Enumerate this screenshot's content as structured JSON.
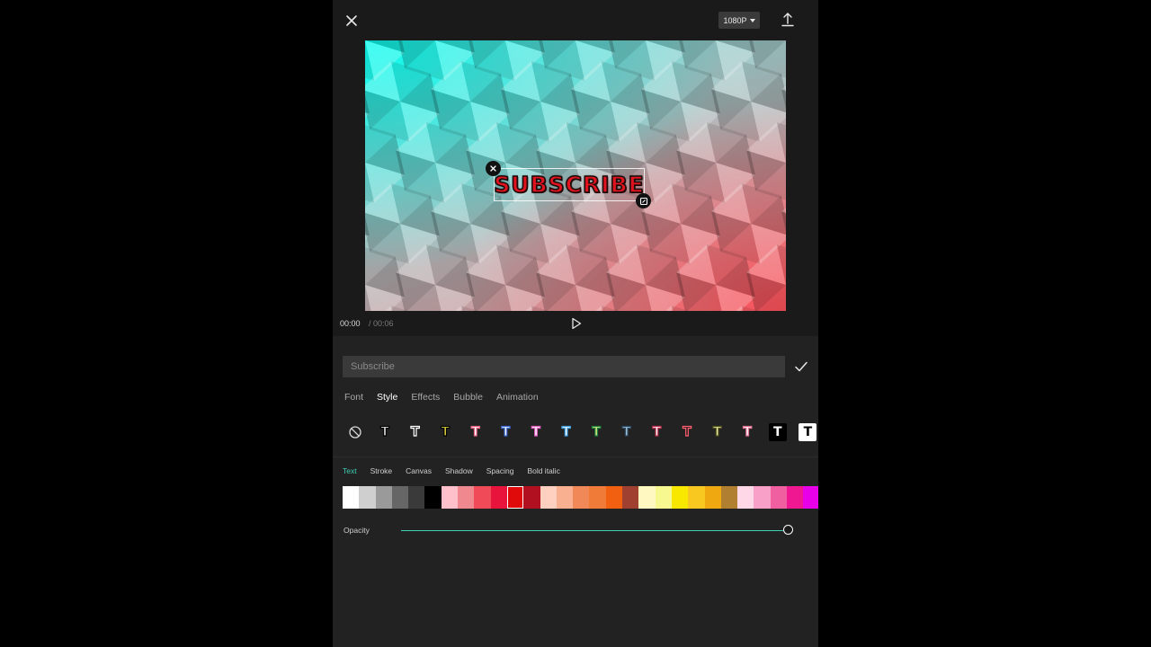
{
  "header": {
    "resolution_label": "1080P",
    "icons": {
      "close": "close-icon",
      "export": "export-icon",
      "dropdown": "caret-down-icon"
    }
  },
  "preview": {
    "overlay_text": "SUBSCRIBE",
    "icons": {
      "delete": "close-icon",
      "scale": "rotate-scale-icon"
    }
  },
  "playback": {
    "current_time": "00:00",
    "total_time": "/ 00:06",
    "icons": {
      "play": "play-icon"
    }
  },
  "editor": {
    "input_placeholder": "Subscribe",
    "icons": {
      "confirm": "checkmark-icon",
      "none_style": "no-style-icon"
    },
    "tabs": [
      "Font",
      "Style",
      "Effects",
      "Bubble",
      "Animation"
    ],
    "active_tab": "Style",
    "sub_tabs": [
      "Text",
      "Stroke",
      "Canvas",
      "Shadow",
      "Spacing",
      "Bold italic"
    ],
    "active_sub_tab": "Text",
    "style_presets": [
      {
        "glyph": "T",
        "fill": "#ffffff",
        "stroke": "#000000",
        "bg": ""
      },
      {
        "glyph": "T",
        "fill": "#1a1a1a",
        "stroke": "#ffffff",
        "bg": ""
      },
      {
        "glyph": "T",
        "fill": "#f0e040",
        "stroke": "#000000",
        "bg": ""
      },
      {
        "glyph": "T",
        "fill": "#ffffff",
        "stroke": "#e86080",
        "bg": ""
      },
      {
        "glyph": "T",
        "fill": "#ffffff",
        "stroke": "#3a6ad0",
        "bg": ""
      },
      {
        "glyph": "T",
        "fill": "#ffffff",
        "stroke": "#e060c0",
        "bg": ""
      },
      {
        "glyph": "T",
        "fill": "#ffffff",
        "stroke": "#40a0e0",
        "bg": ""
      },
      {
        "glyph": "T",
        "fill": "#e0f080",
        "stroke": "#208040",
        "bg": ""
      },
      {
        "glyph": "T",
        "fill": "#a0c8e0",
        "stroke": "#304860",
        "bg": ""
      },
      {
        "glyph": "T",
        "fill": "#ffffff",
        "stroke": "#c03050",
        "bg": ""
      },
      {
        "glyph": "T",
        "fill": "#1a1a1a",
        "stroke": "#ff6070",
        "bg": ""
      },
      {
        "glyph": "T",
        "fill": "#f0f0a0",
        "stroke": "#505020",
        "bg": ""
      },
      {
        "glyph": "T",
        "fill": "#ffffff",
        "stroke": "#e07090",
        "bg": ""
      },
      {
        "glyph": "T",
        "fill": "#ffffff",
        "stroke": "",
        "bg": "#000000"
      },
      {
        "glyph": "T",
        "fill": "#000000",
        "stroke": "",
        "bg": "#ffffff"
      }
    ],
    "colors": [
      "#ffffff",
      "#cfcfcf",
      "#9a9a9a",
      "#666666",
      "#3a3a3a",
      "#000000",
      "#ffc0cc",
      "#f08890",
      "#f04a58",
      "#e8143c",
      "#e00a0a",
      "#b01020",
      "#ffd0c0",
      "#f8b090",
      "#f08858",
      "#f07a38",
      "#f06010",
      "#a04030",
      "#fff8c0",
      "#f8f890",
      "#f8e800",
      "#f8c820",
      "#f0a810",
      "#b08030",
      "#ffd8e8",
      "#f8a0c8",
      "#f060a0",
      "#f01890",
      "#e800e8"
    ],
    "selected_color_index": 10,
    "opacity_label": "Opacity",
    "opacity_value": 1.0
  }
}
